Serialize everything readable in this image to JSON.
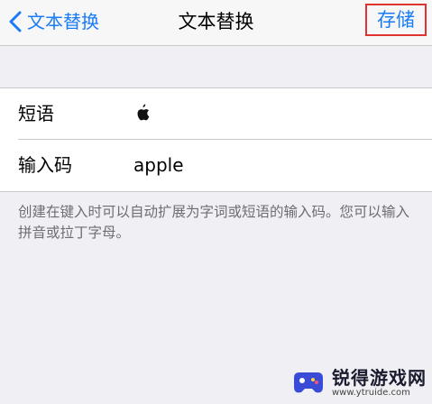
{
  "navbar": {
    "back_label": "文本替换",
    "title": "文本替换",
    "save_label": "存储"
  },
  "form": {
    "phrase_label": "短语",
    "phrase_value_icon": "apple-logo-icon",
    "shortcut_label": "输入码",
    "shortcut_value": "apple"
  },
  "footer": {
    "note": "创建在键入时可以自动扩展为字词或短语的输入码。您可以输入拼音或拉丁字母。"
  },
  "watermark": {
    "title": "锐得游戏网",
    "url": "www.ytruide.com"
  },
  "colors": {
    "accent": "#1a7cf5",
    "highlight_border": "#e0322e",
    "background": "#efeff4"
  }
}
